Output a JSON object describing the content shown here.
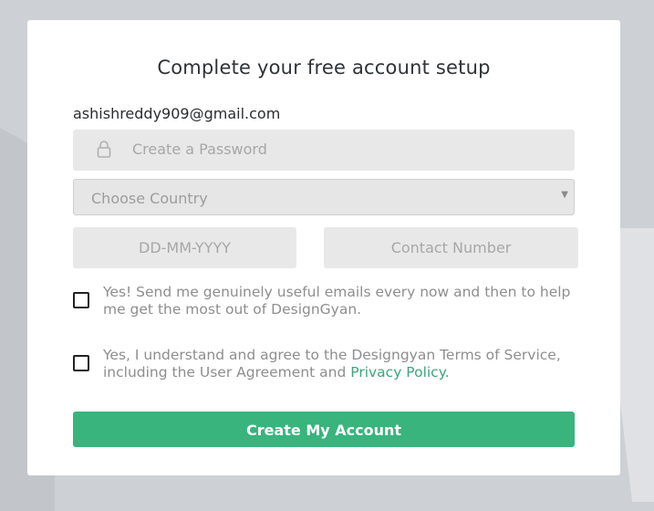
{
  "form": {
    "title": "Complete your free account setup",
    "email": "ashishreddy909@gmail.com",
    "password_placeholder": "Create a Password",
    "country_placeholder": "Choose Country",
    "dob_placeholder": "DD-MM-YYYY",
    "contact_placeholder": "Contact Number",
    "newsletter_label": "Yes! Send me genuinely useful emails every now and then to help me get the most out of DesignGyan.",
    "terms_label_prefix": "Yes, I understand and agree to the Designgyan Terms of Service, including the User Agreement and ",
    "terms_link": "Privacy Policy",
    "terms_label_suffix": ".",
    "submit_label": "Create My Account"
  },
  "icons": {
    "password": "lock-icon",
    "country": "dropdown-arrow-icon"
  },
  "colors": {
    "accent": "#38b47c",
    "link": "#3aa779",
    "field_bg": "#e8e8e8",
    "page_bg": "#cdd0d4"
  }
}
